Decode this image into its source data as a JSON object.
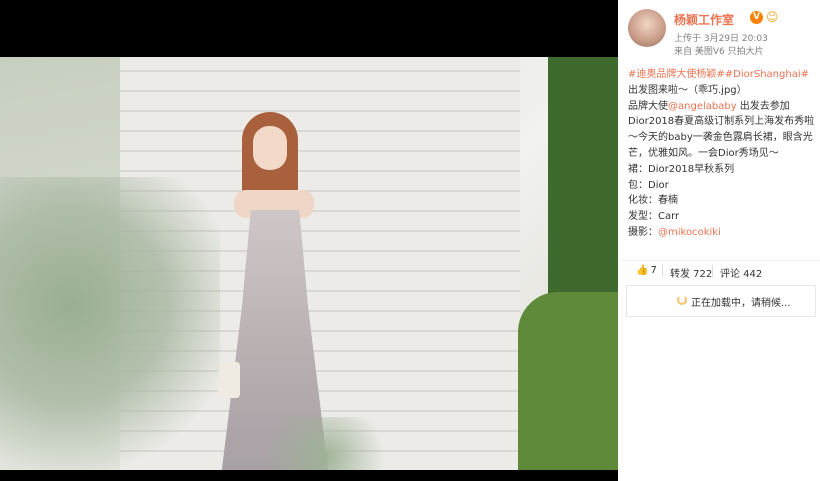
{
  "author": {
    "name": "杨颖工作室",
    "verified": "V",
    "post_time": "上传于 3月29日 20:03",
    "source": "来自 美图V6 只拍大片"
  },
  "post": {
    "tag1": "#迪奥品牌大使杨颖#",
    "tag2": "#DiorShanghai#",
    "line1_tail": "出发图来啦～（乖巧.jpg）",
    "line2_a": "品牌大使",
    "mention1": "@angelababy",
    "line2_b": " 出发去参加Dior2018春夏高级订制系列上海发布秀啦～今天的baby一袭金色露肩长裙，眼含光芒，优雅如风。一会Dior秀场见～",
    "dress": "裙：Dior2018早秋系列",
    "bag": "包：Dior",
    "makeup": "化妆：春楠",
    "hair": "发型：Carr",
    "photo_label": "摄影：",
    "mention2": "@mikocokiki"
  },
  "actions": {
    "like_count": "7",
    "repost_label": "转发 722",
    "comment_label": "评论 442"
  },
  "loading": {
    "text": "正在加载中，请稍候..."
  },
  "icons": {
    "like": "thumbs-up-icon",
    "badge": "vip-emoji-icon",
    "loading": "spinner-icon"
  }
}
